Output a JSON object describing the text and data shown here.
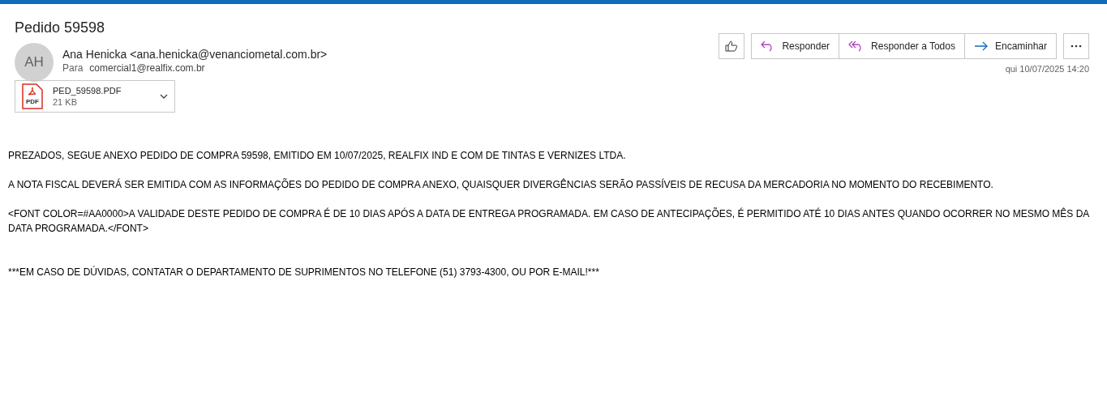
{
  "message": {
    "subject": "Pedido 59598",
    "sender": {
      "initials": "AH",
      "name": "Ana Henicka <ana.henicka@venanciometal.com.br>"
    },
    "to_label": "Para",
    "to": "comercial1@realfix.com.br",
    "date": "qui 10/07/2025 14:20",
    "attachment": {
      "name": "PED_59598.PDF",
      "size": "21 KB",
      "badge": "PDF"
    },
    "actions": [
      {
        "kind": "reply",
        "label": "Responder"
      },
      {
        "kind": "reply_all",
        "label": "Responder a Todos"
      },
      {
        "kind": "forward",
        "label": "Encaminhar"
      }
    ],
    "body": [
      "PREZADOS, SEGUE ANEXO PEDIDO DE COMPRA 59598, EMITIDO EM 10/07/2025, REALFIX IND E COM DE TINTAS E VERNIZES LTDA.",
      "A NOTA FISCAL DEVERÁ SER EMITIDA COM AS INFORMAÇÕES DO PEDIDO DE COMPRA ANEXO, QUAISQUER DIVERGÊNCIAS SERÃO PASSÍVEIS DE RECUSA DA MERCADORIA NO MOMENTO DO RECEBIMENTO.",
      "<FONT COLOR=#AA0000>A VALIDADE DESTE PEDIDO DE COMPRA É DE 10 DIAS APÓS A DATA DE ENTREGA PROGRAMADA. EM CASO DE ANTECIPAÇÕES, É PERMITIDO ATÉ 10 DIAS ANTES QUANDO OCORRER NO MESMO MÊS DA DATA PROGRAMADA.</FONT>",
      "***EM CASO DE DÚVIDAS, CONTATAR O DEPARTAMENTO DE SUPRIMENTOS NO TELEFONE (51) 3793-4300, OU POR E-MAIL!***"
    ]
  }
}
